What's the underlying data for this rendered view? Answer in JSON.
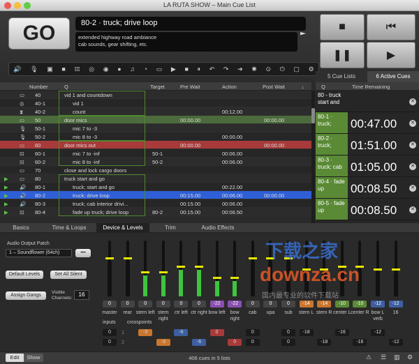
{
  "window": {
    "title": "LA RUTA SHOW – Main Cue List"
  },
  "go_label": "GO",
  "current_cue": {
    "name": "80-2 · truck; drive loop",
    "notes": [
      "extended highway road ambiance",
      "cab sounds, gear shifting, etc."
    ]
  },
  "list_tabs": {
    "cue_lists": "5 Cue Lists",
    "active_cues": "6 Active Cues"
  },
  "columns": {
    "number": "Number",
    "q": "Q",
    "target": "Target",
    "pre_wait": "Pre Wait",
    "action": "Action",
    "post_wait": "Post Wait"
  },
  "cues": [
    {
      "n": "40",
      "q": "vid 1 and countdown",
      "target": "",
      "pre": "",
      "action": "",
      "post": ""
    },
    {
      "n": "40-1",
      "q": "vid 1",
      "target": "",
      "pre": "",
      "action": "",
      "post": ""
    },
    {
      "n": "40-2",
      "q": "count",
      "target": "",
      "pre": "",
      "action": "00:12.00",
      "post": ""
    },
    {
      "n": "50",
      "q": "door mics",
      "target": "",
      "pre": "00:00.00",
      "action": "",
      "post": "00:00.00"
    },
    {
      "n": "50-1",
      "q": "mic 7 to -3",
      "target": "",
      "pre": "",
      "action": "",
      "post": ""
    },
    {
      "n": "50-2",
      "q": "mic 8 to -3",
      "target": "",
      "pre": "",
      "action": "00:00.00",
      "post": ""
    },
    {
      "n": "60",
      "q": "door mics out",
      "target": "",
      "pre": "00:00.00",
      "action": "",
      "post": "00:00.00"
    },
    {
      "n": "60-1",
      "q": "mic 7 to -inf",
      "target": "50-1",
      "pre": "",
      "action": "00:06.00",
      "post": ""
    },
    {
      "n": "60-2",
      "q": "mic 8 to -inf",
      "target": "50-2",
      "pre": "",
      "action": "00:06.00",
      "post": ""
    },
    {
      "n": "70",
      "q": "close and lock cargo doors",
      "target": "",
      "pre": "",
      "action": "",
      "post": ""
    },
    {
      "n": "80",
      "q": "truck start and go",
      "target": "",
      "pre": "",
      "action": "",
      "post": ""
    },
    {
      "n": "80-1",
      "q": "truck; start and go",
      "target": "",
      "pre": "",
      "action": "00:22.00",
      "post": ""
    },
    {
      "n": "80-2",
      "q": "truck; drive loop",
      "target": "",
      "pre": "00:15.00",
      "action": "00:06.00",
      "post": "00:00.00"
    },
    {
      "n": "80-3",
      "q": "truck; cab interior drivi...",
      "target": "",
      "pre": "00:15.00",
      "action": "00:06.00",
      "post": ""
    },
    {
      "n": "80-4",
      "q": "fade up truck; drive loop",
      "target": "80-2",
      "pre": "00:15.00",
      "action": "00:06.50",
      "post": ""
    }
  ],
  "active_header": {
    "q": "Q",
    "time": "Time Remaining"
  },
  "active_cues": [
    {
      "q": "80 - truck start and",
      "time": ""
    },
    {
      "q": "80-1 · truck;",
      "time": "00:47.00"
    },
    {
      "q": "80-2 · truck;",
      "time": "01:51.00"
    },
    {
      "q": "80-3 · truck; cab",
      "time": "01:05.00"
    },
    {
      "q": "80-4 · fade up",
      "time": "00:08.50"
    },
    {
      "q": "80-5 · fade up",
      "time": "00:08.50"
    }
  ],
  "inspector_tabs": [
    "Basics",
    "Time & Loops",
    "Device & Levels",
    "Trim",
    "Audio Effects"
  ],
  "device": {
    "patch_label": "Audio Output Patch",
    "patch_value": "1 – Soundflower (64ch)",
    "default_levels": "Default Levels",
    "set_all_silent": "Set All Silent",
    "assign_gangs": "Assign Gangs",
    "visible_channels_label": "Visible Channels:",
    "visible_channels": "16",
    "more": "•••"
  },
  "channels": [
    {
      "label": "master",
      "val": "0",
      "level": 0.7
    },
    {
      "label": "rear",
      "val": "0",
      "level": 0.7
    },
    {
      "label": "stern left",
      "val": "0",
      "level": 0.45
    },
    {
      "label": "stern right",
      "val": "0",
      "level": 0.45
    },
    {
      "label": "ctr left",
      "val": "0",
      "level": 0.55
    },
    {
      "label": "ctr right",
      "val": "0",
      "level": 0.55
    },
    {
      "label": "bow left",
      "val": "-22",
      "level": 0.35
    },
    {
      "label": "bow right",
      "val": "-22",
      "level": 0.35
    },
    {
      "label": "cab",
      "val": "0",
      "level": 0.7
    },
    {
      "label": "upa",
      "val": "0",
      "level": 0.7
    },
    {
      "label": "sub",
      "val": "0",
      "level": 0.7
    },
    {
      "label": "stern L",
      "val": "-14",
      "level": 0.5
    },
    {
      "label": "stern R",
      "val": "-14",
      "level": 0.5
    },
    {
      "label": "center L",
      "val": "-10",
      "level": 0.55
    },
    {
      "label": "center R",
      "val": "-10",
      "level": 0.55
    },
    {
      "label": "bow L verb",
      "val": "-12",
      "level": 0.5
    },
    {
      "label": "16",
      "val": "-12",
      "level": 0.5
    }
  ],
  "row_labels": {
    "inputs": "inputs",
    "crosspoints": "crosspoints",
    "r1": "1",
    "r2": "2"
  },
  "crosspoints_row1": [
    "0",
    "",
    "-3",
    "",
    "-6",
    "",
    "0",
    "",
    "0",
    "",
    "0",
    "-18",
    "",
    "-16",
    "",
    "-12",
    ""
  ],
  "crosspoints_row2": [
    "0",
    "",
    "",
    "-3",
    "",
    "-6",
    "",
    "0",
    "0",
    "",
    "0",
    "",
    "-18",
    "",
    "-16",
    "",
    "-12"
  ],
  "status": {
    "edit": "Edit",
    "show": "Show",
    "count": "406 cues in 5 lists"
  },
  "watermark": {
    "cn": "下载之家",
    "url": "downza.cn",
    "slogan": "国内最专业的软件下载站"
  }
}
